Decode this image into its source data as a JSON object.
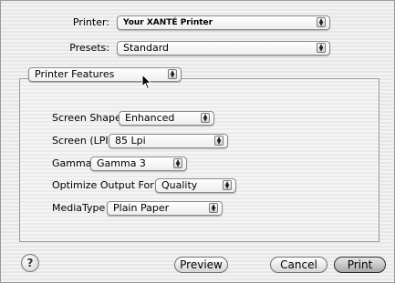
{
  "printer": {
    "label": "Printer:",
    "value": "Your XANTÉ Printer"
  },
  "presets": {
    "label": "Presets:",
    "value": "Standard"
  },
  "panel": {
    "value": "Printer Features"
  },
  "features": [
    {
      "label": "Screen Shape",
      "value": "Enhanced"
    },
    {
      "label": "Screen (LPI)",
      "value": "85 Lpi"
    },
    {
      "label": "Gamma",
      "value": "Gamma 3"
    },
    {
      "label": "Optimize Output For",
      "value": "Quality"
    },
    {
      "label": "MediaType",
      "value": "Plain Paper"
    }
  ],
  "footer": {
    "help": "?",
    "preview": "Preview",
    "cancel": "Cancel",
    "print": "Print"
  },
  "icons": {
    "popup_arrows": "up-down-arrows-icon",
    "help": "question-mark-icon",
    "cursor": "mouse-pointer-icon"
  }
}
